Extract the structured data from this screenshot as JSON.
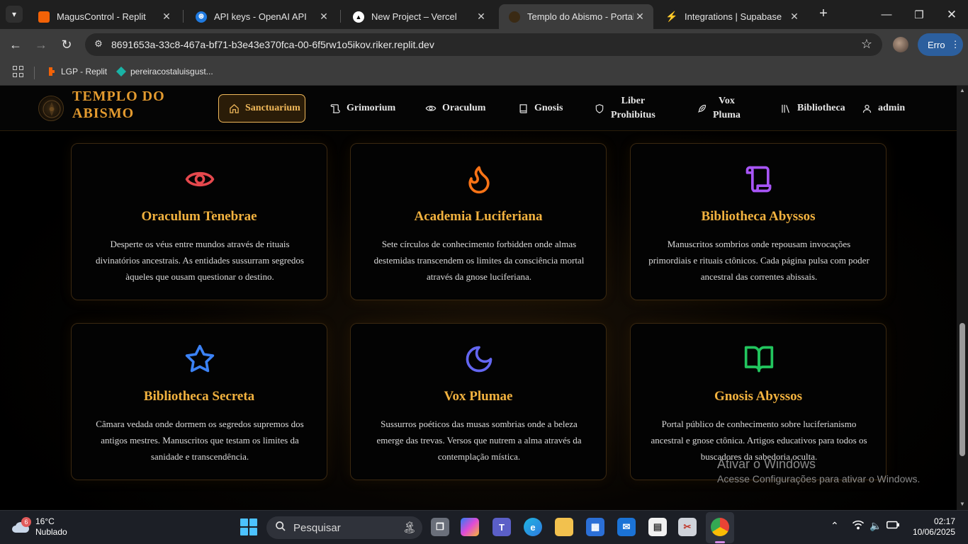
{
  "browser": {
    "tabs": [
      {
        "title": "MagusControl - Replit",
        "active": false
      },
      {
        "title": "API keys - OpenAI API",
        "active": false
      },
      {
        "title": "New Project – Vercel",
        "active": false
      },
      {
        "title": "Templo do Abismo - Portal d",
        "active": true
      },
      {
        "title": "Integrations | Supabase",
        "active": false
      }
    ],
    "url": "8691653a-33c8-467a-bf71-b3e43e370fca-00-6f5rw1o5ikov.riker.replit.dev",
    "error_button": "Erro",
    "bookmarks": [
      {
        "label": "LGP - Replit"
      },
      {
        "label": "pereiracostaluisgust..."
      }
    ]
  },
  "site": {
    "logo": {
      "line1": "TEMPLO DO",
      "line2": "ABISMO"
    },
    "nav": [
      {
        "label": "Sanctuarium",
        "icon": "home-icon",
        "active": true
      },
      {
        "label": "Grimorium",
        "icon": "scroll-icon"
      },
      {
        "label": "Oraculum",
        "icon": "eye-icon"
      },
      {
        "label": "Gnosis",
        "icon": "book-icon"
      },
      {
        "label_line1": "Liber",
        "label_line2": "Prohibitus",
        "icon": "shield-icon"
      },
      {
        "label_line1": "Vox",
        "label_line2": "Pluma",
        "icon": "feather-icon"
      },
      {
        "label": "Bibliotheca",
        "icon": "library-icon"
      },
      {
        "label": "admin",
        "icon": "user-icon"
      }
    ],
    "cards": [
      {
        "icon": "eye-icon",
        "color": "#e5484d",
        "title": "Oraculum Tenebrae",
        "description": "Desperte os véus entre mundos através de rituais divinatórios ancestrais. As entidades sussurram segredos àqueles que ousam questionar o destino."
      },
      {
        "icon": "flame-icon",
        "color": "#f97316",
        "title": "Academia Luciferiana",
        "description": "Sete círculos de conhecimento forbidden onde almas destemidas transcendem os limites da consciência mortal através da gnose luciferiana."
      },
      {
        "icon": "scroll-icon",
        "color": "#a855f7",
        "title": "Bibliotheca Abyssos",
        "description": "Manuscritos sombrios onde repousam invocações primordiais e rituais ctônicos. Cada página pulsa com poder ancestral das correntes abissais."
      },
      {
        "icon": "star-icon",
        "color": "#3b82f6",
        "title": "Bibliotheca Secreta",
        "description": "Câmara vedada onde dormem os segredos supremos dos antigos mestres. Manuscritos que testam os limites da sanidade e transcendência."
      },
      {
        "icon": "moon-icon",
        "color": "#6366f1",
        "title": "Vox Plumae",
        "description": "Sussurros poéticos das musas sombrias onde a beleza emerge das trevas. Versos que nutrem a alma através da contemplação mística."
      },
      {
        "icon": "open-book-icon",
        "color": "#22c55e",
        "title": "Gnosis Abyssos",
        "description": "Portal público de conhecimento sobre luciferianismo ancestral e gnose ctônica. Artigos educativos para todos os buscadores da sabedoria oculta."
      }
    ]
  },
  "watermark": {
    "line1": "Ativar o Windows",
    "line2": "Acesse Configurações para ativar o Windows."
  },
  "taskbar": {
    "weather_badge": "6",
    "temperature": "16°C",
    "condition": "Nublado",
    "search_placeholder": "Pesquisar",
    "time": "02:17",
    "date": "10/06/2025"
  }
}
